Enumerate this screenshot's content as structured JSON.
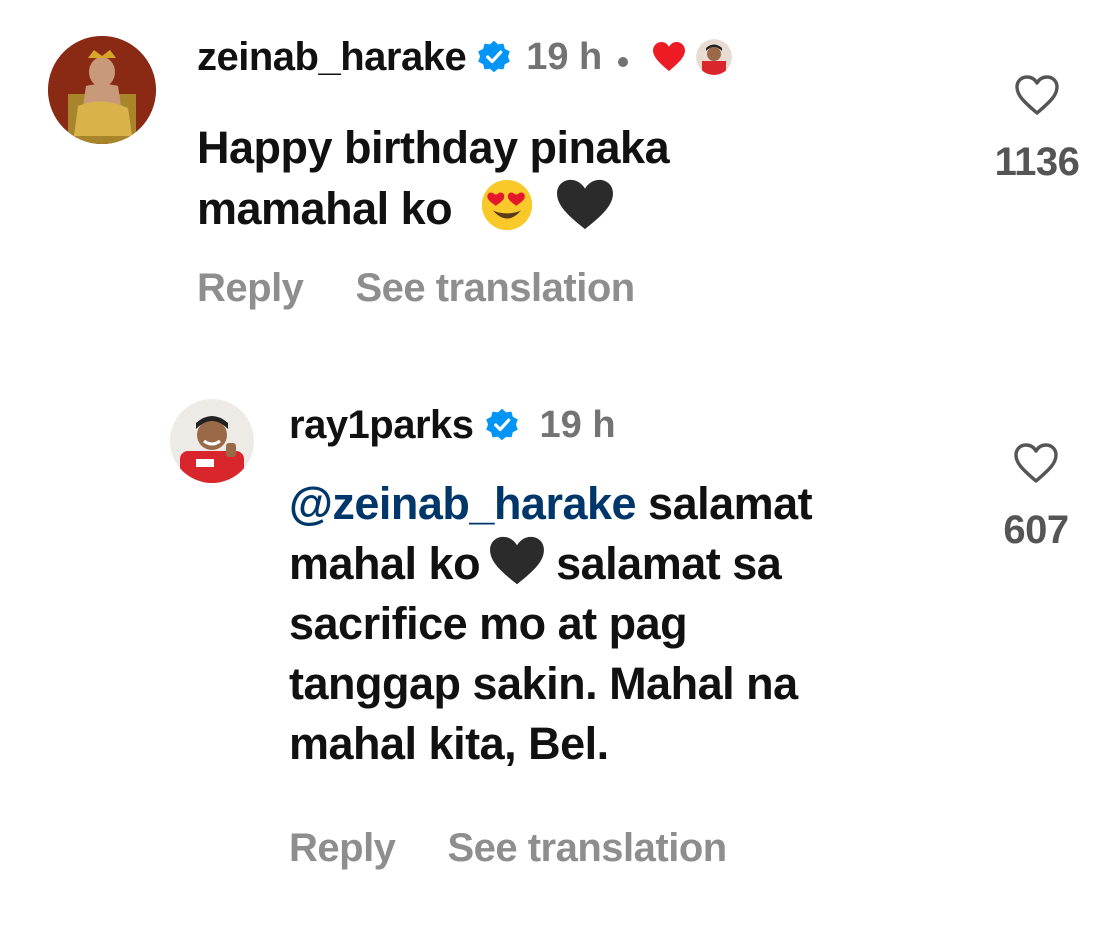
{
  "comments": [
    {
      "username": "zeinab_harake",
      "time": "19 h",
      "text_line1": "Happy birthday pinaka",
      "text_line2": "mamahal ko",
      "likes": "1136",
      "reply_label": "Reply",
      "translate_label": "See translation",
      "verified": true,
      "liked_by_creator": true
    },
    {
      "username": "ray1parks",
      "time": "19 h",
      "mention": "@zeinab_harake",
      "text_line1_rest": " salamat",
      "text_line2_a": "mahal ko",
      "text_line2_b": "salamat sa",
      "text_line3": "sacrifice mo at pag",
      "text_line4": "tanggap sakin. Mahal na",
      "text_line5": "mahal kita, Bel.",
      "likes": "607",
      "reply_label": "Reply",
      "translate_label": "See translation",
      "verified": true
    }
  ],
  "colors": {
    "verified_blue": "#0095f6",
    "mention": "#00376b",
    "muted": "#8e8e8e",
    "creator_heart": "#ed1c24"
  }
}
